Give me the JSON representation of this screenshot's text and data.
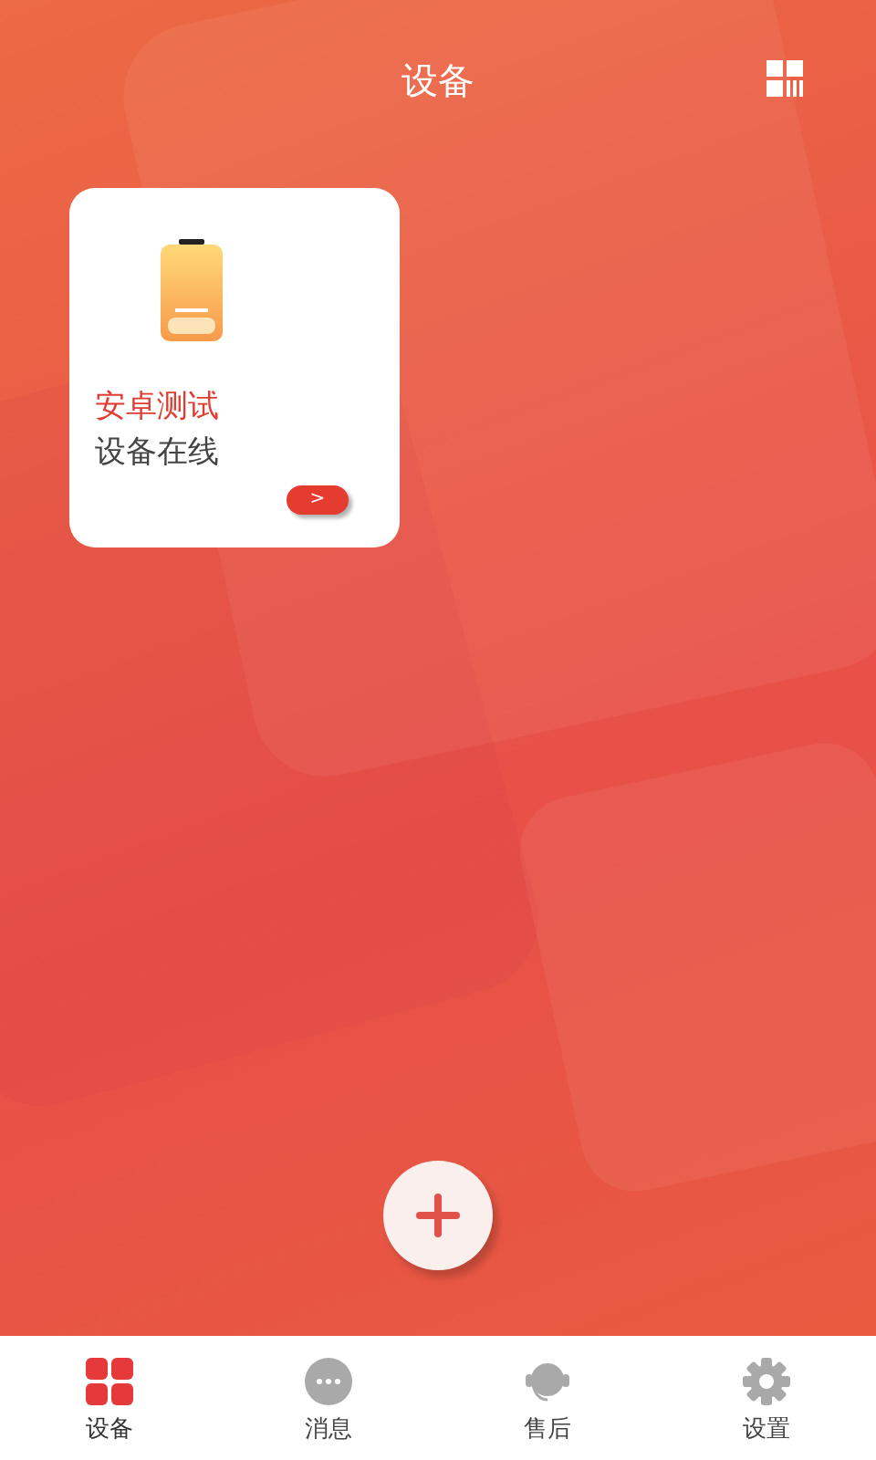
{
  "header": {
    "title": "设备"
  },
  "devices": [
    {
      "name": "安卓测试",
      "status": "设备在线",
      "button": ">"
    }
  ],
  "tabs": [
    {
      "label": "设备",
      "kind": "grid",
      "selected": true
    },
    {
      "label": "消息",
      "kind": "chat",
      "selected": false
    },
    {
      "label": "售后",
      "kind": "headset",
      "selected": false
    },
    {
      "label": "设置",
      "kind": "gear",
      "selected": false
    }
  ]
}
